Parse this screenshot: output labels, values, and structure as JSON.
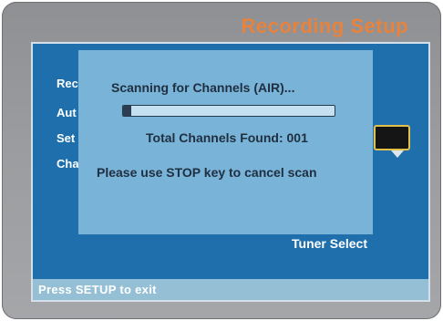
{
  "colors": {
    "accent_title": "#e7833c",
    "panel_blue": "#1f6fad",
    "dialog_blue": "#79b3d8",
    "status_bar": "#94bfd5",
    "frame_gray": "#9a9c9f",
    "dropdown_border": "#e3c04a"
  },
  "screen": {
    "title": "Recording Setup"
  },
  "menu": {
    "items": [
      {
        "label": "Rec"
      },
      {
        "label": "Aut"
      },
      {
        "label": "Set"
      },
      {
        "label": "Cha"
      }
    ],
    "dropdown_icon": "chevron-down-icon",
    "tuner_select": "Tuner Select"
  },
  "dialog": {
    "title": "Scanning for Channels (AIR)...",
    "progress_percent": 4,
    "channels_found": "Total Channels Found: 001",
    "hint": "Please use STOP key to cancel scan"
  },
  "status": {
    "text": "Press SETUP to exit"
  }
}
